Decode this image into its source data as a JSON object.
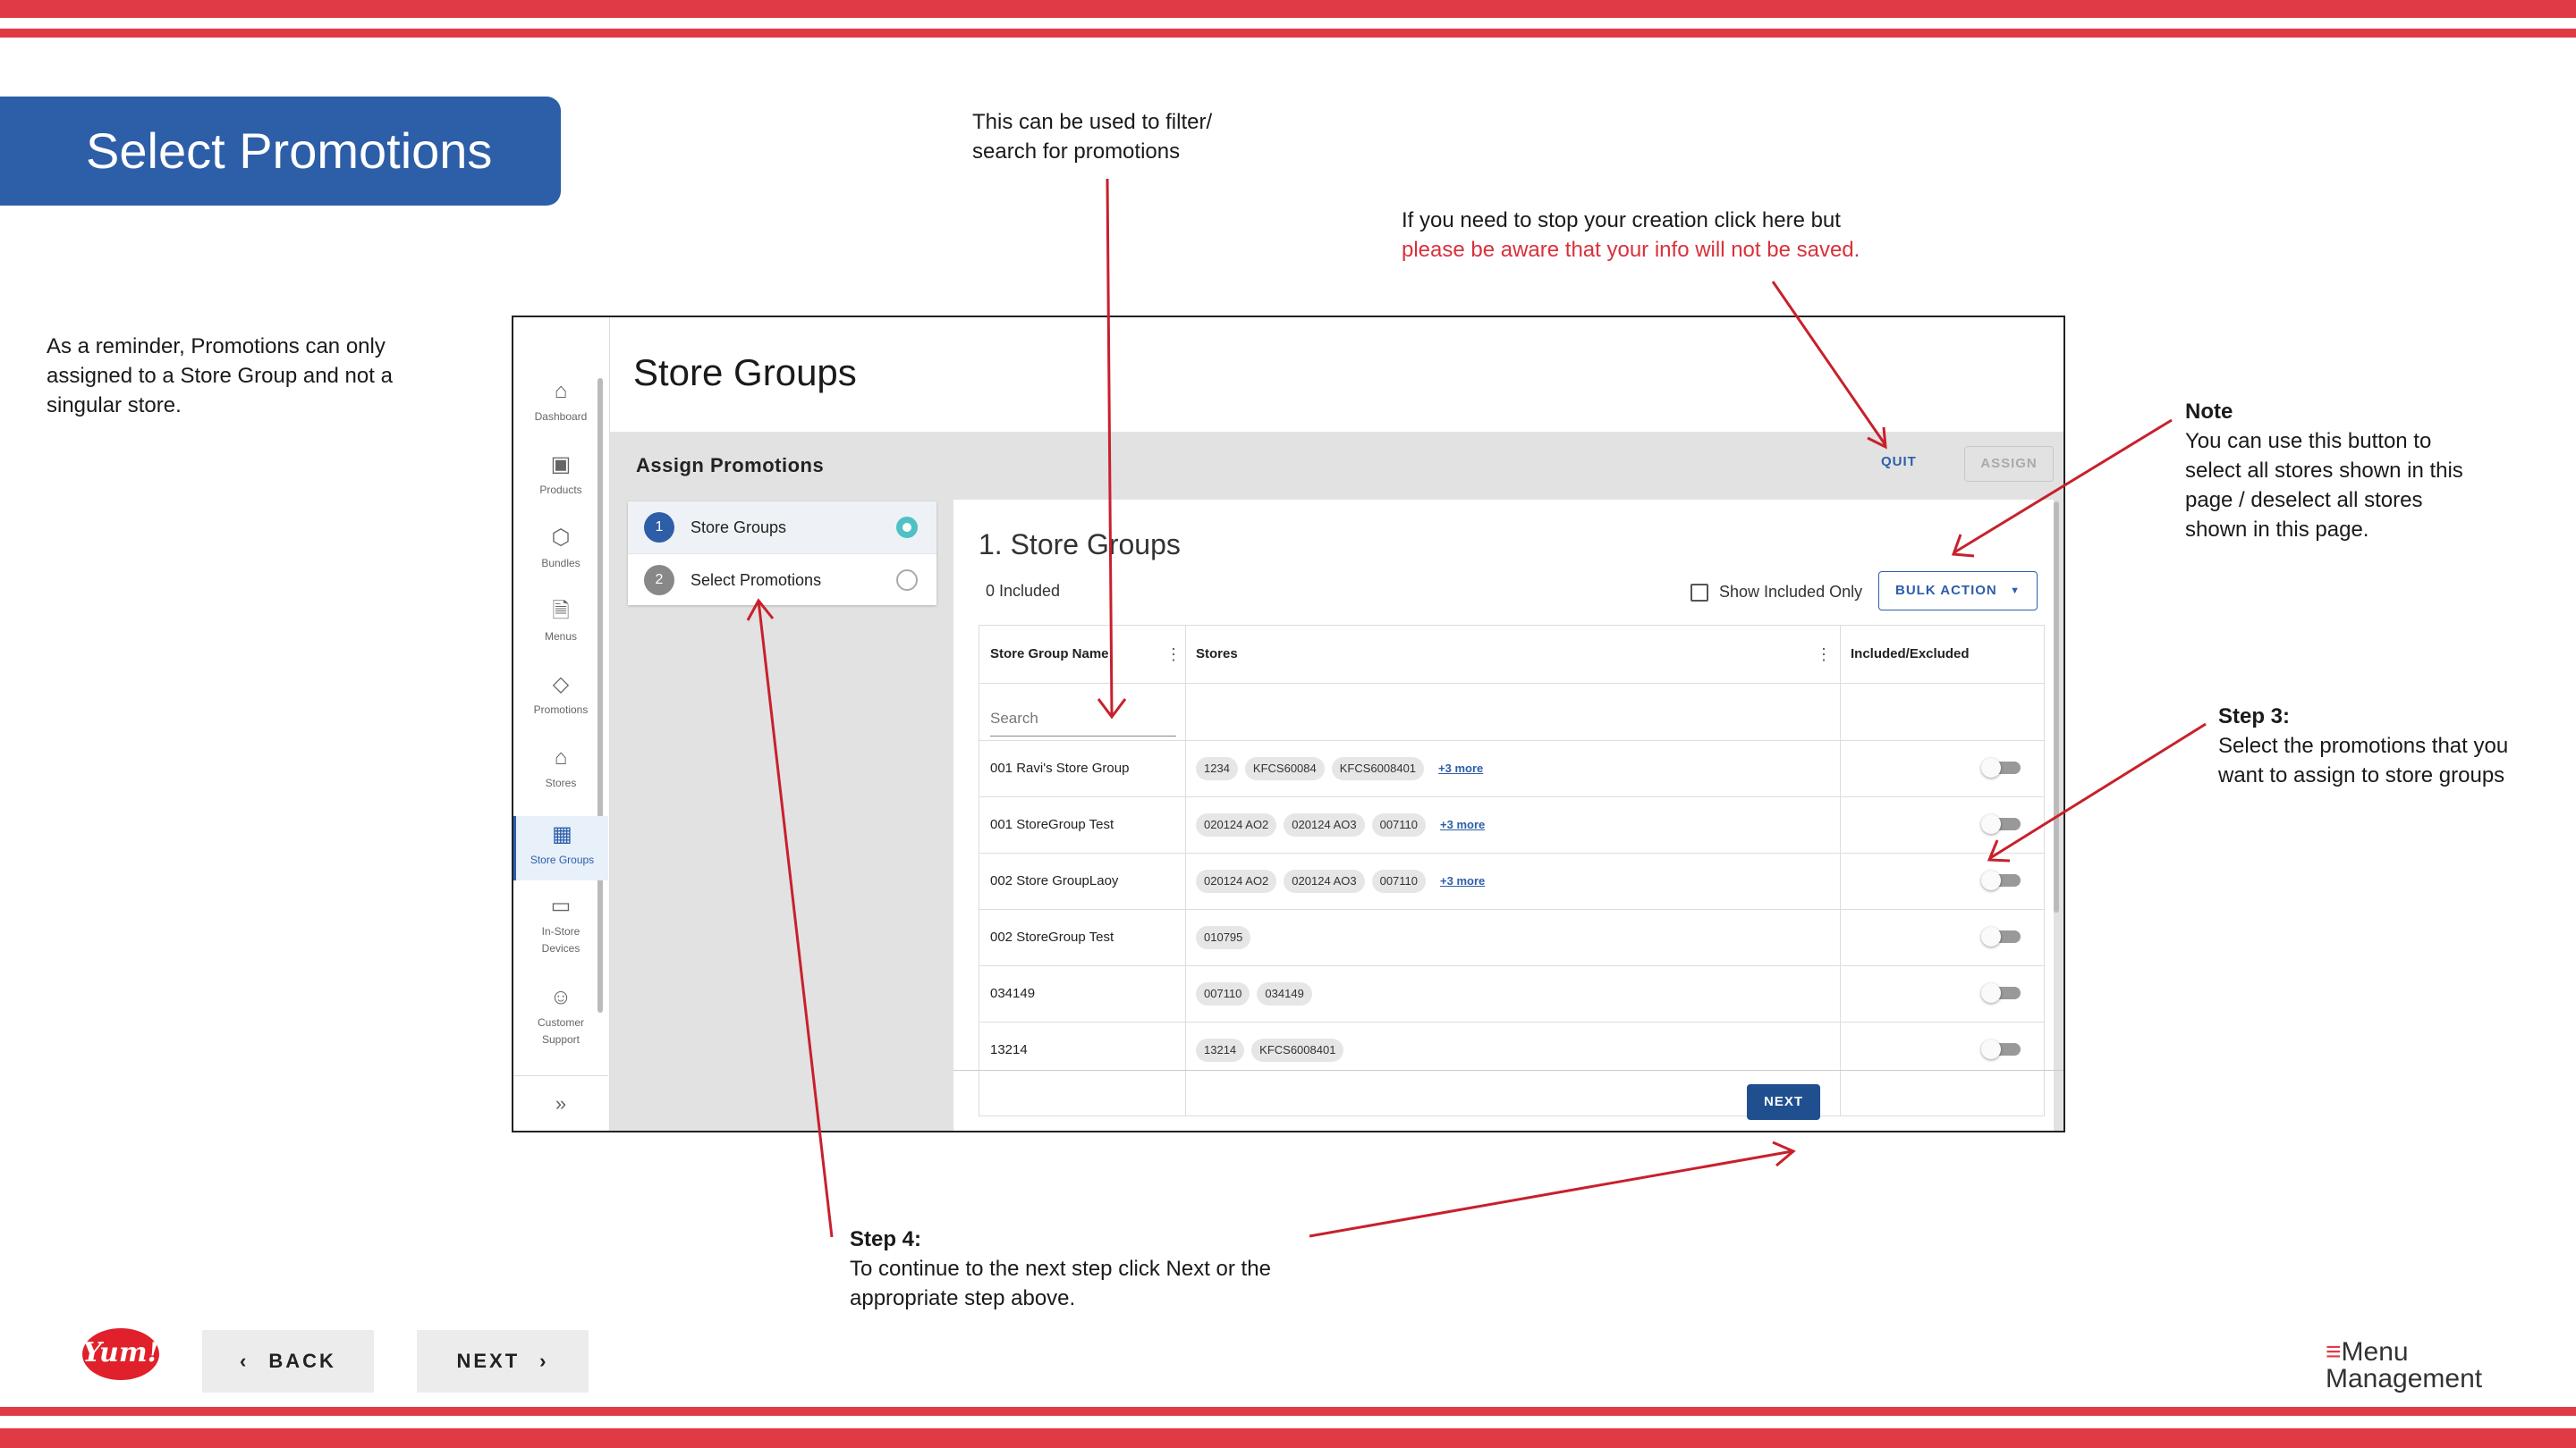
{
  "slide": {
    "title": "Select Promotions",
    "reminder": "As a reminder, Promotions can only assigned to a Store Group and not a singular store.",
    "callout_filter": "This can be used to filter/ search for promotions",
    "callout_quit_line1": "If you need to stop your creation click here but",
    "callout_quit_line2": "please be aware that your info will not be saved.",
    "note_title": "Note",
    "note_text": "You can use this button to select all stores shown in this page / deselect all stores shown in this page.",
    "step3_title": "Step 3:",
    "step3_text": "Select the promotions that you want to assign to store groups",
    "step4_title": "Step 4:",
    "step4_text": "To continue to the next step click Next or the appropriate step above.",
    "back_label": "BACK",
    "next_label": "NEXT",
    "yum_logo": "Yum!",
    "mm_logo_line1": "Menu",
    "mm_logo_line2": "Management",
    "accent_color": "#e03a45",
    "brand_color": "#2d5ea8"
  },
  "app": {
    "sidebar": [
      {
        "label": "Dashboard",
        "icon": "home-icon"
      },
      {
        "label": "Products",
        "icon": "box-icon"
      },
      {
        "label": "Bundles",
        "icon": "cube-icon"
      },
      {
        "label": "Menus",
        "icon": "document-icon"
      },
      {
        "label": "Promotions",
        "icon": "tag-icon"
      },
      {
        "label": "Stores",
        "icon": "store-icon"
      },
      {
        "label": "Store Groups",
        "icon": "grid-icon"
      },
      {
        "label": "In-Store Devices",
        "icon": "monitor-icon"
      },
      {
        "label": "Customer Support",
        "icon": "support-icon"
      }
    ],
    "page_title": "Store Groups",
    "section_title": "Assign Promotions",
    "quit_label": "QUIT",
    "assign_label": "ASSIGN",
    "steps": [
      {
        "num": "1",
        "label": "Store Groups"
      },
      {
        "num": "2",
        "label": "Select Promotions"
      }
    ],
    "panel_title": "1. Store Groups",
    "included_count": "0 Included",
    "show_included_label": "Show Included Only",
    "bulk_action_label": "BULK ACTION",
    "columns": [
      "Store Group Name",
      "Stores",
      "Included/Excluded"
    ],
    "search_placeholder": "Search",
    "rows": [
      {
        "name": "001 Ravi's Store Group",
        "stores": [
          "1234",
          "KFCS60084",
          "KFCS6008401"
        ],
        "more": "+3 more"
      },
      {
        "name": "001 StoreGroup Test",
        "stores": [
          "020124 AO2",
          "020124 AO3",
          "007110"
        ],
        "more": "+3 more"
      },
      {
        "name": "002 Store GroupLaoy",
        "stores": [
          "020124 AO2",
          "020124 AO3",
          "007110"
        ],
        "more": "+3 more"
      },
      {
        "name": "002 StoreGroup Test",
        "stores": [
          "010795"
        ],
        "more": ""
      },
      {
        "name": "034149",
        "stores": [
          "007110",
          "034149"
        ],
        "more": ""
      },
      {
        "name": "13214",
        "stores": [
          "13214",
          "KFCS6008401"
        ],
        "more": ""
      }
    ],
    "next_label": "NEXT"
  }
}
